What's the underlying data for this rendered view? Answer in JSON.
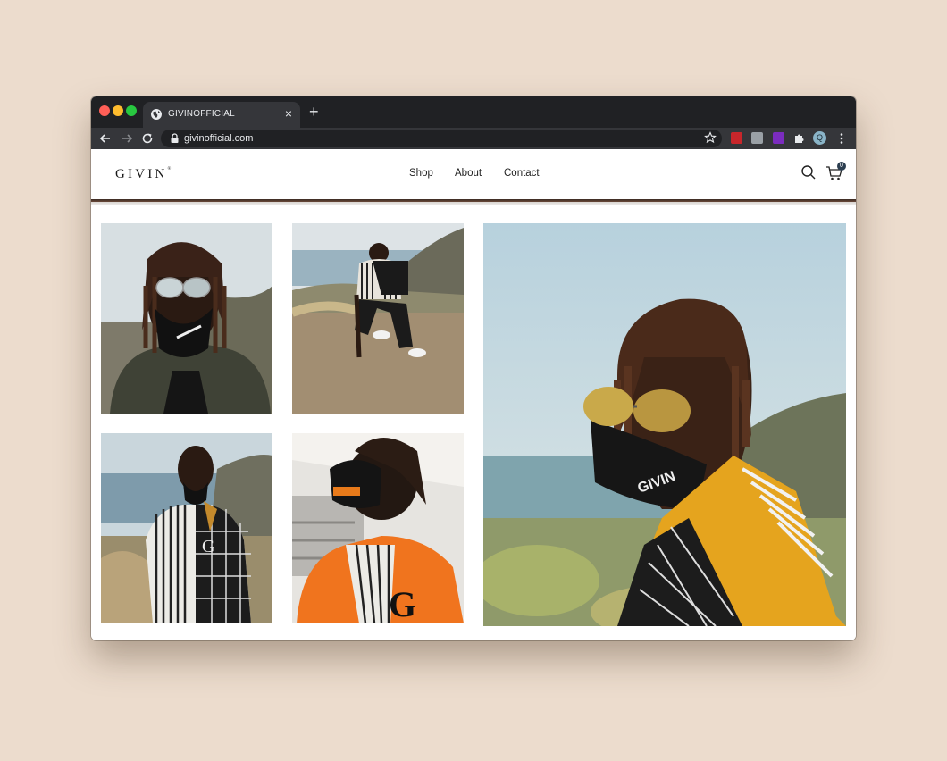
{
  "browser": {
    "tab_title": "GIVINOFFICIAL",
    "url": "givinofficial.com",
    "profile_initial": "Q",
    "icons": [
      "back-icon",
      "forward-icon",
      "reload-icon",
      "lock-icon",
      "star-icon",
      "puzzle-icon",
      "kebab-icon"
    ]
  },
  "site": {
    "logo": "GIVIN",
    "logo_mark": "®",
    "nav": [
      {
        "label": "Shop"
      },
      {
        "label": "About"
      },
      {
        "label": "Contact"
      }
    ],
    "cart_count": "0"
  },
  "gallery": {
    "photos": [
      {
        "name": "photo-masked-aviators-closeup"
      },
      {
        "name": "photo-crouching-on-hillside"
      },
      {
        "name": "photo-striped-grid-shirt"
      },
      {
        "name": "photo-orange-jacket"
      },
      {
        "name": "photo-feature-yellow-collar"
      }
    ]
  },
  "colors": {
    "page_bg": "#ecdccd",
    "chrome_dark": "#202124",
    "chrome_mid": "#35363a",
    "cart_badge": "#2c3e50"
  }
}
